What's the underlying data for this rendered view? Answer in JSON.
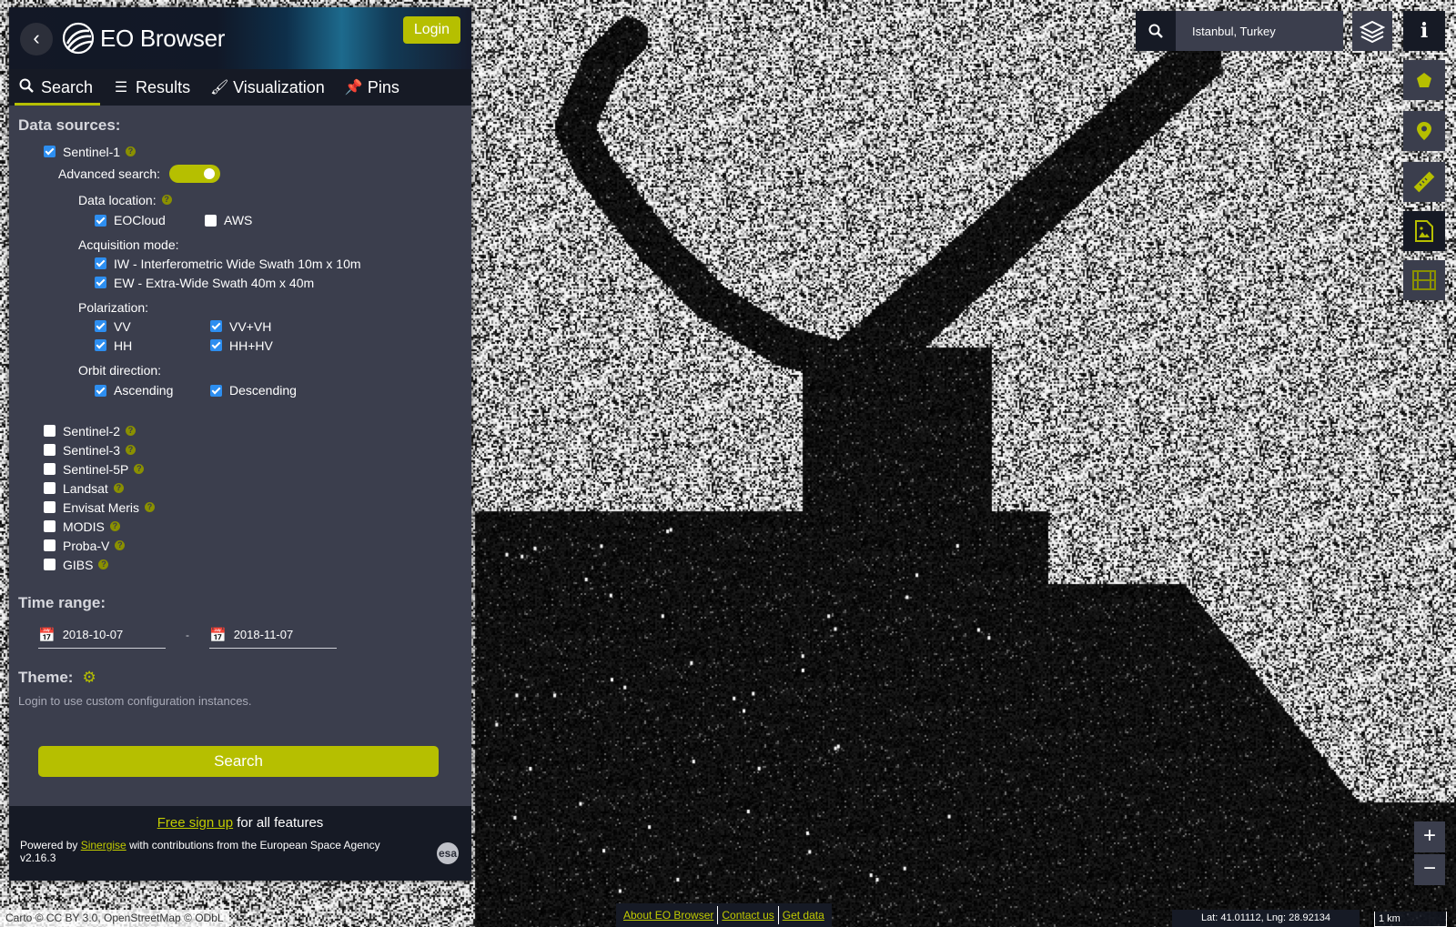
{
  "header": {
    "app_title": "EO Browser",
    "login_label": "Login"
  },
  "tabs": [
    {
      "label": "Search",
      "icon": "search-icon",
      "active": true
    },
    {
      "label": "Results",
      "icon": "list-icon",
      "active": false
    },
    {
      "label": "Visualization",
      "icon": "brush-icon",
      "active": false
    },
    {
      "label": "Pins",
      "icon": "pin-icon",
      "active": false
    }
  ],
  "data_sources": {
    "title": "Data sources:",
    "sentinel1": {
      "label": "Sentinel-1",
      "checked": true,
      "advanced_label": "Advanced search:",
      "advanced_on": true,
      "data_location": {
        "title": "Data location:",
        "options": [
          {
            "label": "EOCloud",
            "checked": true
          },
          {
            "label": "AWS",
            "checked": false
          }
        ]
      },
      "acquisition_mode": {
        "title": "Acquisition mode:",
        "options": [
          {
            "label": "IW - Interferometric Wide Swath 10m x 10m",
            "checked": true
          },
          {
            "label": "EW - Extra-Wide Swath 40m x 40m",
            "checked": true
          }
        ]
      },
      "polarization": {
        "title": "Polarization:",
        "options": [
          {
            "label": "VV",
            "checked": true
          },
          {
            "label": "VV+VH",
            "checked": true
          },
          {
            "label": "HH",
            "checked": true
          },
          {
            "label": "HH+HV",
            "checked": true
          }
        ]
      },
      "orbit_direction": {
        "title": "Orbit direction:",
        "options": [
          {
            "label": "Ascending",
            "checked": true
          },
          {
            "label": "Descending",
            "checked": true
          }
        ]
      }
    },
    "others": [
      {
        "label": "Sentinel-2",
        "checked": false
      },
      {
        "label": "Sentinel-3",
        "checked": false
      },
      {
        "label": "Sentinel-5P",
        "checked": false
      },
      {
        "label": "Landsat",
        "checked": false
      },
      {
        "label": "Envisat Meris",
        "checked": false
      },
      {
        "label": "MODIS",
        "checked": false
      },
      {
        "label": "Proba-V",
        "checked": false
      },
      {
        "label": "GIBS",
        "checked": false
      }
    ]
  },
  "time_range": {
    "title": "Time range:",
    "from": "2018-10-07",
    "separator": "-",
    "to": "2018-11-07"
  },
  "theme": {
    "title": "Theme:",
    "hint": "Login to use custom configuration instances."
  },
  "search_button_label": "Search",
  "footer": {
    "signup_link": "Free sign up",
    "signup_rest": " for all features",
    "powered_prefix": "Powered by ",
    "powered_link": "Sinergise",
    "powered_suffix": " with contributions from the European Space Agency",
    "version": "v2.16.3",
    "esa_logo_text": "esa"
  },
  "location_search": {
    "value": "Istanbul, Turkey"
  },
  "toolbar": [
    "layers-icon",
    "info-icon",
    "polygon-icon",
    "location-pin-icon",
    "ruler-icon",
    "image-export-icon",
    "film-icon"
  ],
  "zoom": {
    "in": "+",
    "out": "−"
  },
  "bottom": {
    "attribution": "Carto © CC BY 3.0, OpenStreetMap © ODbL",
    "links": [
      "About EO Browser",
      "Contact us",
      "Get data"
    ],
    "coords": "Lat: 41.01112, Lng: 28.92134",
    "scale": "1 km"
  },
  "colors": {
    "accent": "#b6bf00",
    "panel": "#3b3e4d",
    "panel_dark": "#161a25",
    "checkbox": "#2d8ef0"
  }
}
